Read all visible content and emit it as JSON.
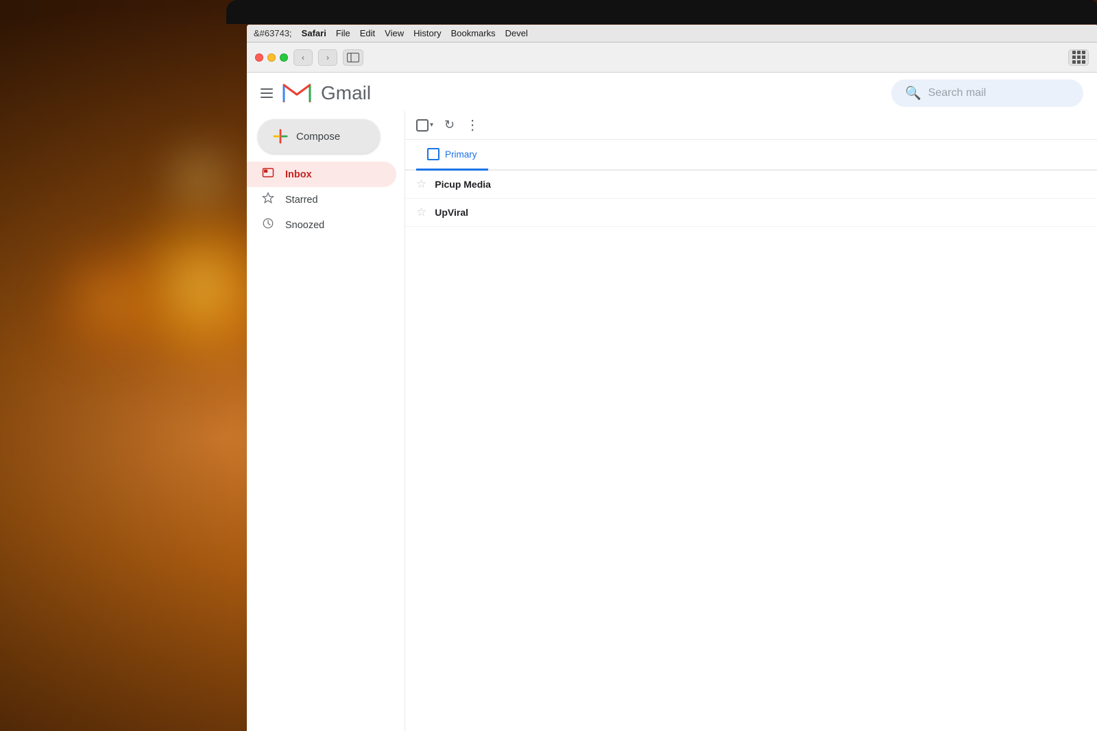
{
  "background": {
    "description": "warm bokeh background with glowing lights"
  },
  "menubar": {
    "apple": "&#63743;",
    "items": [
      "Safari",
      "File",
      "Edit",
      "View",
      "History",
      "Bookmarks",
      "Develop"
    ],
    "bold_item": "Safari"
  },
  "safari_toolbar": {
    "back_btn": "‹",
    "forward_btn": "›",
    "sidebar_toggle": "sidebar",
    "grid_btn": "grid"
  },
  "gmail": {
    "hamburger_label": "menu",
    "logo_m": "M",
    "logo_text": "Gmail",
    "search_placeholder": "Search mail",
    "compose_label": "Compose",
    "toolbar": {
      "checkbox_label": "select",
      "refresh_label": "refresh",
      "more_label": "more"
    },
    "tabs": [
      {
        "label": "Primary",
        "active": true
      }
    ],
    "nav_items": [
      {
        "label": "Inbox",
        "active": true,
        "icon": "inbox"
      },
      {
        "label": "Starred",
        "active": false,
        "icon": "star"
      },
      {
        "label": "Snoozed",
        "active": false,
        "icon": "clock"
      }
    ],
    "emails": [
      {
        "sender": "Picup Media",
        "starred": false
      },
      {
        "sender": "UpViral",
        "starred": false
      }
    ]
  }
}
